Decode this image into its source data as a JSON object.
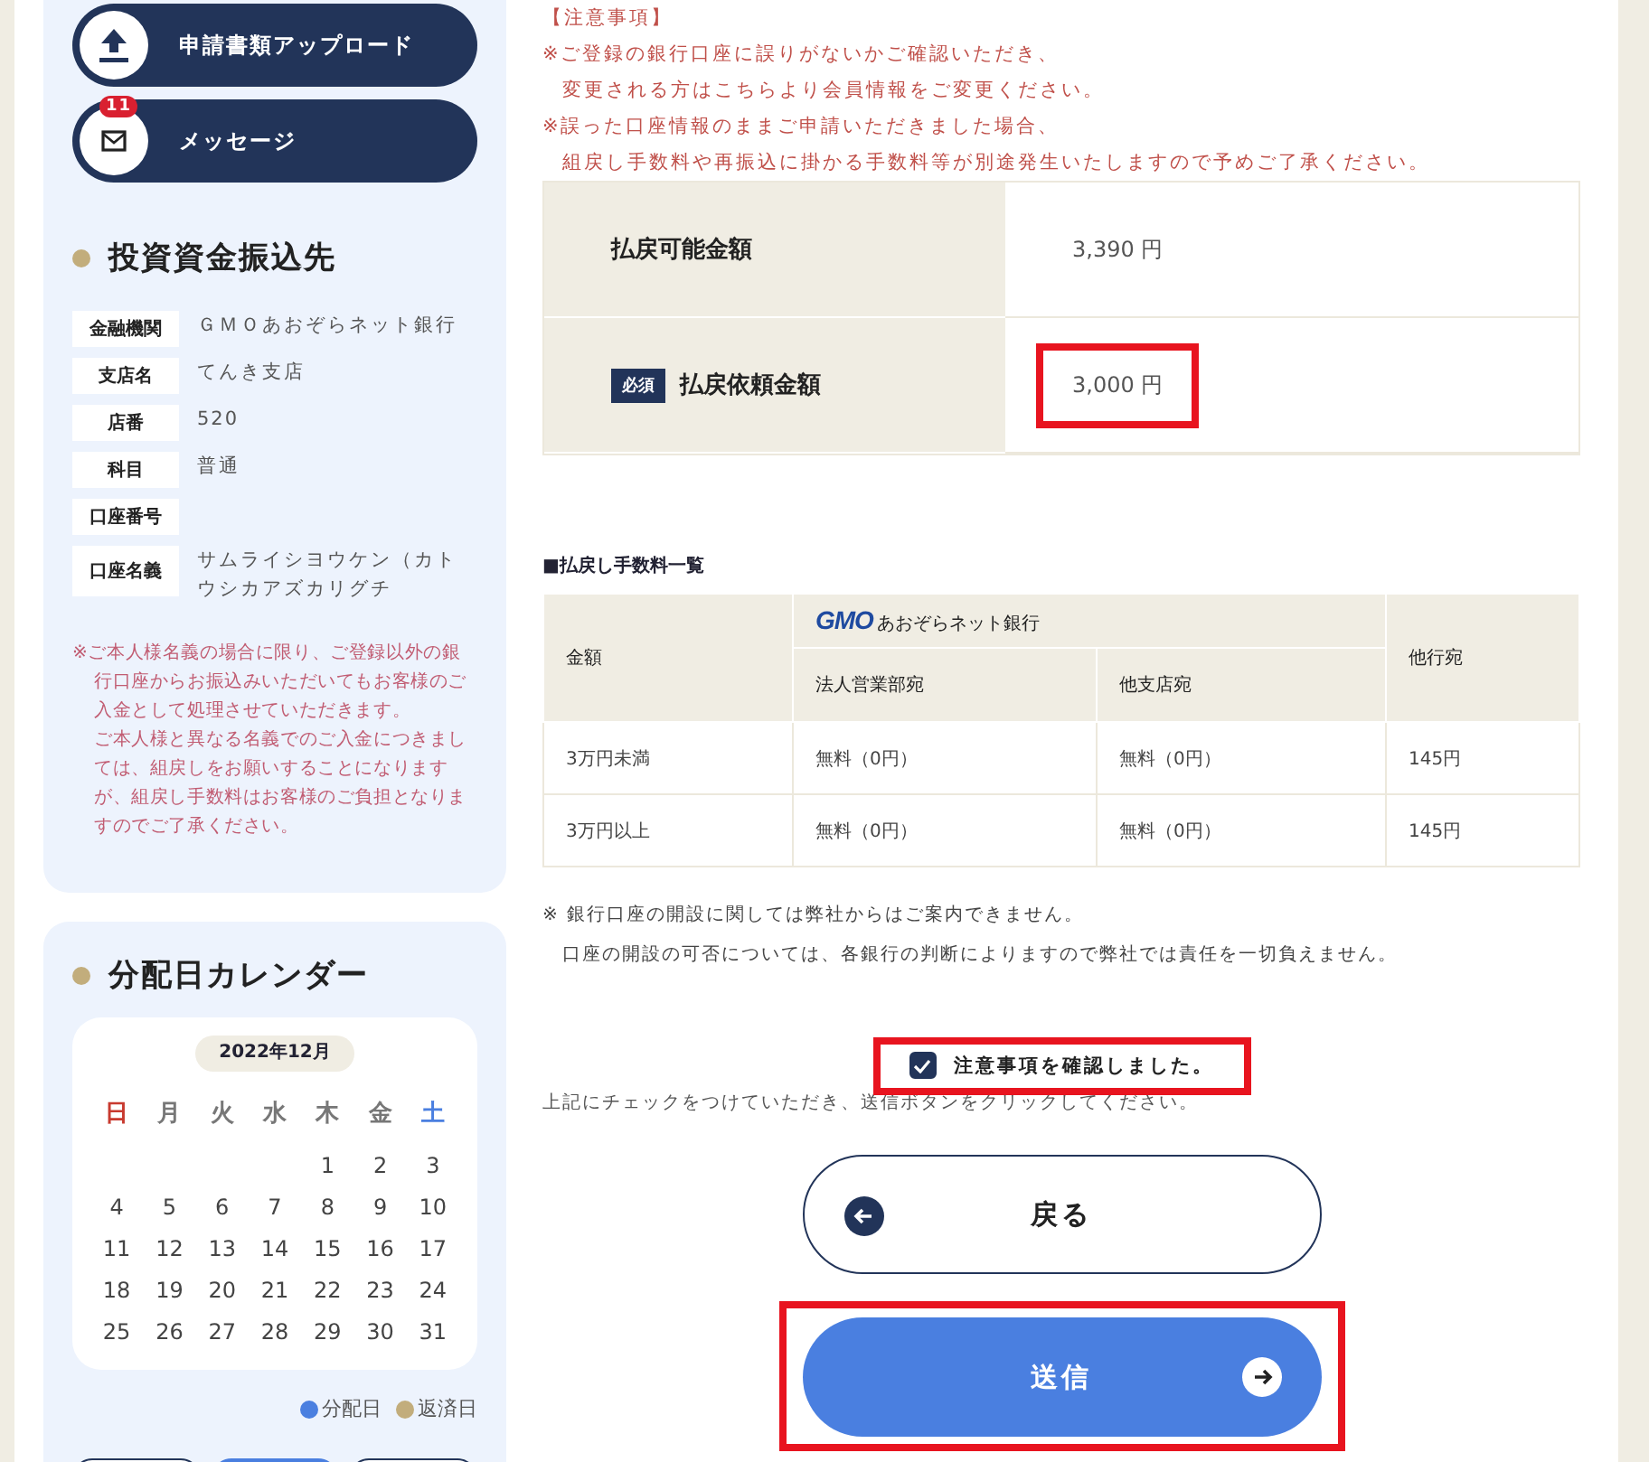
{
  "sidebar": {
    "nav_buttons": [
      {
        "label": "申請書類アップロード",
        "kind": "upload"
      },
      {
        "label": "メッセージ",
        "kind": "message",
        "badge": "11"
      }
    ],
    "transfer": {
      "title": "投資資金振込先",
      "rows": [
        {
          "label": "金融機関",
          "value": "ＧＭＯあおぞらネット銀行"
        },
        {
          "label": "支店名",
          "value": "てんき支店"
        },
        {
          "label": "店番",
          "value": "520"
        },
        {
          "label": "科目",
          "value": "普通"
        },
        {
          "label": "口座番号"
        },
        {
          "label": "口座名義",
          "value": "サムライシヨウケン（カトウシカアズカリグチ"
        }
      ],
      "note": [
        "※ご本人様名義の場合に限り、ご登録以外の銀行口座からお振込みいただいてもお客様のご入金として処理させていただきます。",
        "ご本人様と異なる名義でのご入金につきましては、組戻しをお願いすることになりますが、組戻し手数料はお客様のご負担となりますのでご了承ください。"
      ]
    },
    "calendar": {
      "title": "分配日カレンダー",
      "month": "2022年12月",
      "weekdays": [
        {
          "label": "日",
          "kind": "sunday"
        },
        {
          "label": "月",
          "kind": "weekday"
        },
        {
          "label": "火",
          "kind": "weekday"
        },
        {
          "label": "水",
          "kind": "weekday"
        },
        {
          "label": "木",
          "kind": "weekday"
        },
        {
          "label": "金",
          "kind": "weekday"
        },
        {
          "label": "土",
          "kind": "saturday"
        }
      ],
      "weeks": [
        [
          "1",
          "2",
          "3"
        ],
        [
          "4",
          "5",
          "6",
          "7",
          "8",
          "9",
          "10"
        ],
        [
          "11",
          "12",
          "13",
          "14",
          "15",
          "16",
          "17"
        ],
        [
          "18",
          "19",
          "20",
          "21",
          "22",
          "23",
          "24"
        ],
        [
          "25",
          "26",
          "27",
          "28",
          "29",
          "30",
          "31"
        ]
      ],
      "legend": [
        {
          "label": "分配日",
          "color": "#4a7fe0"
        },
        {
          "label": "返済日",
          "color": "#c2ad7c"
        }
      ],
      "month_buttons": [
        {
          "selected": false
        },
        {
          "selected": true
        },
        {
          "selected": false
        }
      ]
    }
  },
  "main": {
    "notice": {
      "title": "【注意事項】",
      "notes": [
        {
          "lines": [
            "※ご登録の銀行口座に誤りがないかご確認いただき、",
            "変更される方はこちらより会員情報をご変更ください。"
          ]
        },
        {
          "lines": [
            "※誤った口座情報のままご申請いただきました場合、",
            "組戻し手数料や再振込に掛かる手数料等が別途発生いたしますので予めご了承ください。"
          ]
        }
      ]
    },
    "amounts": [
      {
        "label": "払戻可能金額",
        "value": "3,390 円",
        "required": false,
        "highlighted": false
      },
      {
        "label": "払戻依頼金額",
        "value": "3,000 円",
        "required": true,
        "badge": "必須",
        "highlighted": true
      }
    ],
    "fee_table": {
      "title": "■払戻し手数料一覧",
      "amount_header": "金額",
      "bank_logo": "GMO",
      "bank_name": "あおぞらネット銀行",
      "sub_headers": [
        "法人営業部宛",
        "他支店宛"
      ],
      "other_header": "他行宛",
      "rows": [
        [
          "3万円未満",
          "無料（0円）",
          "無料（0円）",
          "145円"
        ],
        [
          "3万円以上",
          "無料（0円）",
          "無料（0円）",
          "145円"
        ]
      ]
    },
    "footnote": [
      "※ 銀行口座の開設に関しては弊社からはご案内できません。",
      "口座の開設の可否については、各銀行の判断によりますので弊社では責任を一切負えません。"
    ],
    "confirm": {
      "label": "注意事項を確認しました。",
      "checked": true,
      "highlighted": true
    },
    "hint": "上記にチェックをつけていただき、送信ボタンをクリックしてください。",
    "buttons": [
      {
        "label": "戻る",
        "kind": "back",
        "highlighted": false
      },
      {
        "label": "送信",
        "kind": "submit",
        "highlighted": true
      }
    ]
  }
}
